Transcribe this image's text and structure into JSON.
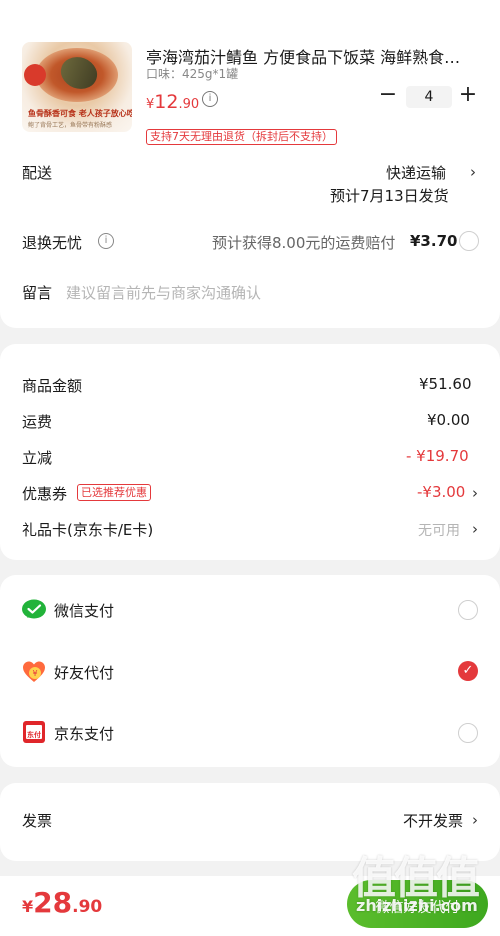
{
  "product": {
    "title": "亭海湾茄汁鲭鱼 方便食品下饭菜 海鲜熟食…",
    "spec": "口味：425g*1罐",
    "price_currency": "¥",
    "price_int": "12",
    "price_dec": ".90",
    "quantity": "4",
    "qty_minus": "−",
    "qty_plus": "+",
    "return_badge": "支持7天无理由退货（拆封后不支持）",
    "image_caption_1": "鱼骨酥香可食 老人孩子放心吃",
    "image_caption_2": "鲍了背骨工艺，鱼骨带有粉酥感"
  },
  "delivery": {
    "label": "配送",
    "method": "快递运输",
    "estimate": "预计7月13日发货"
  },
  "return_insurance": {
    "label": "退换无忧",
    "desc": "预计获得8.00元的运费赔付",
    "price": "¥3.70"
  },
  "message": {
    "label": "留言",
    "placeholder": "建议留言前先与商家沟通确认"
  },
  "costs": {
    "goods_label": "商品金额",
    "goods_value": "¥51.60",
    "shipping_label": "运费",
    "shipping_value": "¥0.00",
    "discount_label": "立减",
    "discount_value": "- ¥19.70",
    "coupon_label": "优惠券",
    "coupon_badge": "已选推荐优惠",
    "coupon_value": "-¥3.00",
    "giftcard_label": "礼品卡(京东卡/E卡)",
    "giftcard_value": "无可用"
  },
  "payment": {
    "wechat_label": "微信支付",
    "friend_label": "好友代付",
    "jd_label": "京东支付",
    "jd_icon_text": "东付",
    "selected": "friend"
  },
  "invoice": {
    "label": "发票",
    "value": "不开发票"
  },
  "footer": {
    "total_currency": "¥",
    "total_int": "28",
    "total_dec": ".90",
    "submit_label": "微信好友代付",
    "watermark": "值值值",
    "watermark_url": "zhizhizhi.com"
  },
  "colors": {
    "accent_red": "#e4393c",
    "wechat_green": "#3ea81f"
  }
}
